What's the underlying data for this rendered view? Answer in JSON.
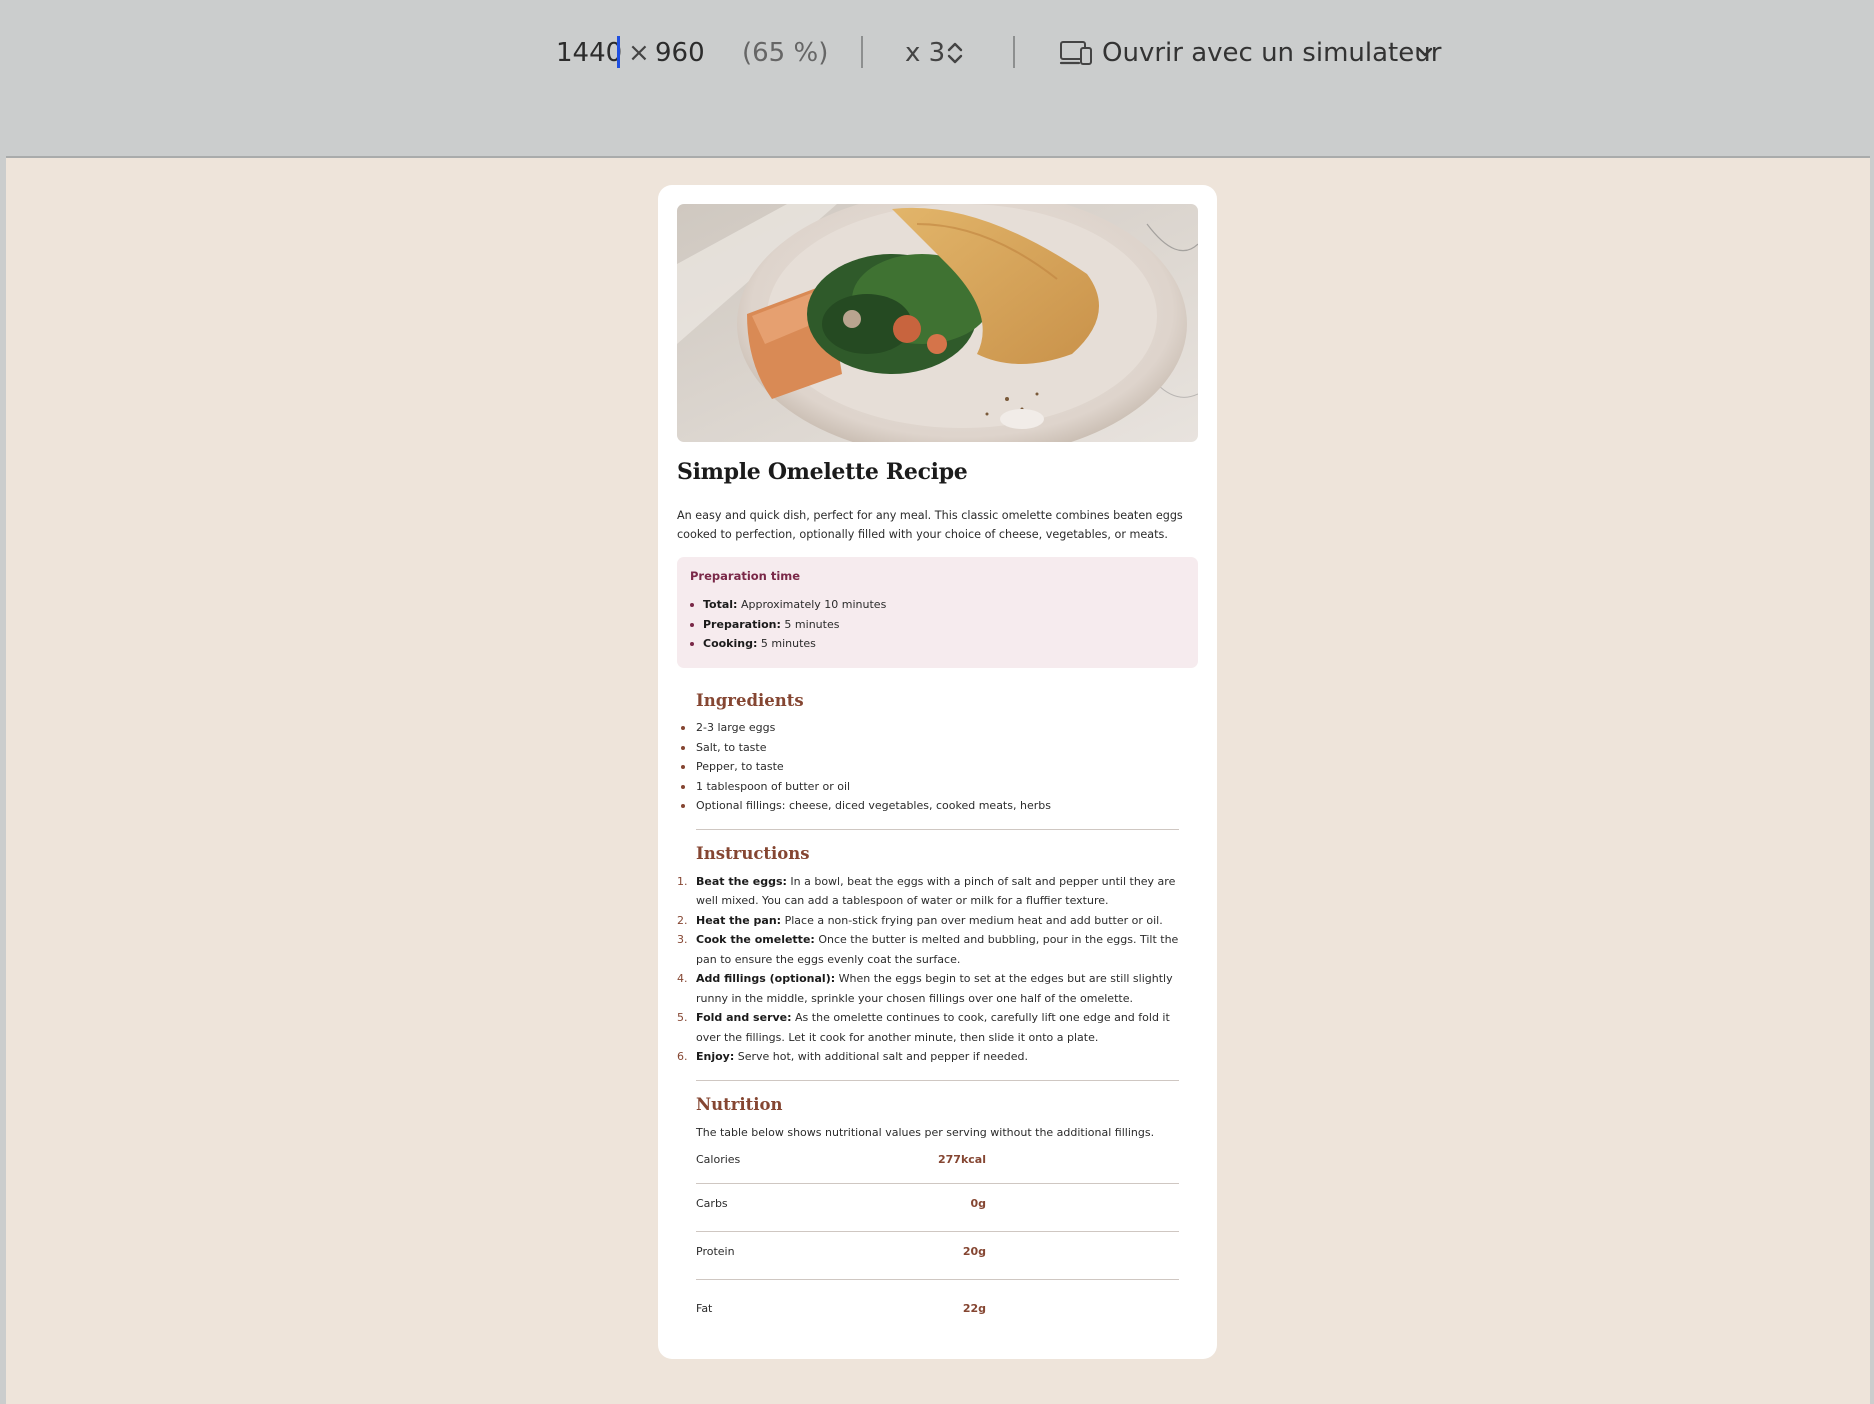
{
  "toolbar": {
    "width": "1440",
    "times": "×",
    "height": "960",
    "zoom": "(65 %)",
    "dpr": "x 3",
    "simulator_label": "Ouvrir avec un simulateur"
  },
  "recipe": {
    "title": "Simple Omelette Recipe",
    "intro": "An easy and quick dish, perfect for any meal. This classic omelette combines beaten eggs cooked to perfection, optionally filled with your choice of cheese, vegetables, or meats.",
    "prep": {
      "title": "Preparation time",
      "items": [
        {
          "label": "Total:",
          "value": "Approximately 10 minutes"
        },
        {
          "label": "Preparation:",
          "value": "5 minutes"
        },
        {
          "label": "Cooking:",
          "value": "5 minutes"
        }
      ]
    },
    "ingredients": {
      "title": "Ingredients",
      "items": [
        "2-3 large eggs",
        "Salt, to taste",
        "Pepper, to taste",
        "1 tablespoon of butter or oil",
        "Optional fillings: cheese, diced vegetables, cooked meats, herbs"
      ]
    },
    "instructions": {
      "title": "Instructions",
      "steps": [
        {
          "num": "1.",
          "label": "Beat the eggs:",
          "text": "In a bowl, beat the eggs with a pinch of salt and pepper until they are well mixed. You can add a tablespoon of water or milk for a fluffier texture."
        },
        {
          "num": "2.",
          "label": "Heat the pan:",
          "text": "Place a non-stick frying pan over medium heat and add butter or oil."
        },
        {
          "num": "3.",
          "label": "Cook the omelette:",
          "text": "Once the butter is melted and bubbling, pour in the eggs. Tilt the pan to ensure the eggs evenly coat the surface."
        },
        {
          "num": "4.",
          "label": "Add fillings (optional):",
          "text": "When the eggs begin to set at the edges but are still slightly runny in the middle, sprinkle your chosen fillings over one half of the omelette."
        },
        {
          "num": "5.",
          "label": "Fold and serve:",
          "text": "As the omelette continues to cook, carefully lift one edge and fold it over the fillings. Let it cook for another minute, then slide it onto a plate."
        },
        {
          "num": "6.",
          "label": "Enjoy:",
          "text": "Serve hot, with additional salt and pepper if needed."
        }
      ]
    },
    "nutrition": {
      "title": "Nutrition",
      "text": "The table below shows nutritional values per serving without the additional fillings.",
      "rows": [
        {
          "label": "Calories",
          "value": "277kcal"
        },
        {
          "label": "Carbs",
          "value": "0g"
        },
        {
          "label": "Protein",
          "value": "20g"
        },
        {
          "label": "Fat",
          "value": "22g"
        }
      ]
    }
  },
  "colors": {
    "page_bg": "#eee4da",
    "card_bg": "#ffffff",
    "accent_brown": "#854632",
    "accent_rose": "#7a2848",
    "prep_bg": "#f6ebee"
  }
}
